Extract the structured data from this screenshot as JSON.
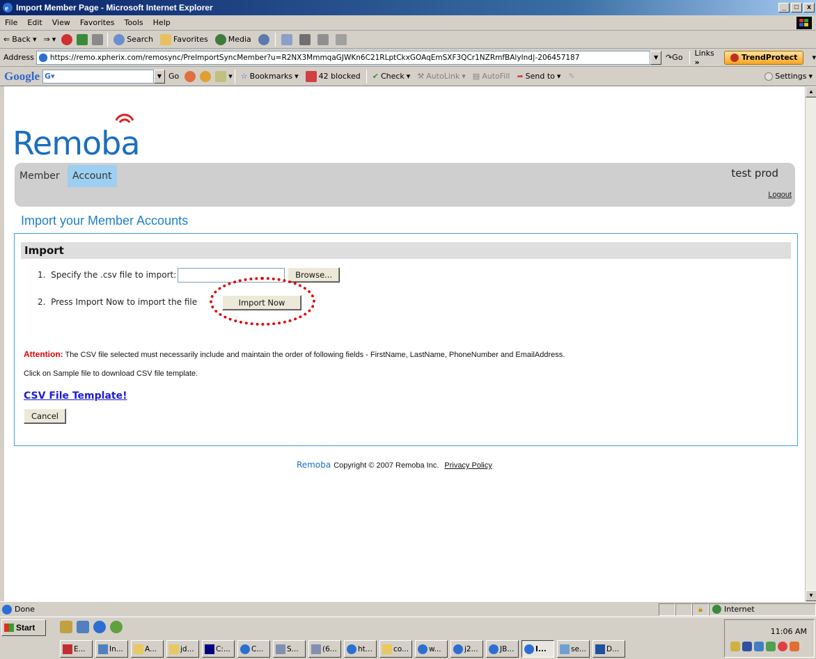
{
  "window": {
    "title": "Import Member Page - Microsoft Internet Explorer",
    "buttons": {
      "minimize": "_",
      "maximize": "□",
      "close": "x"
    }
  },
  "menu": [
    "File",
    "Edit",
    "View",
    "Favorites",
    "Tools",
    "Help"
  ],
  "toolbar": {
    "back": "Back",
    "search": "Search",
    "favorites": "Favorites",
    "media": "Media"
  },
  "address": {
    "label": "Address",
    "url": "https://remo.xpherix.com/remosync/PreImportSyncMember?u=R2NX3MmmqaGJWKn6C21RLptCkxGOAqEmSXF3QCr1NZRmfBAlyInd|-206457187",
    "go": "Go",
    "links": "Links",
    "links_chevron": "»",
    "trend": "TrendProtect"
  },
  "googlebar": {
    "logo": "Google",
    "go": "Go",
    "bookmarks": "Bookmarks",
    "blocked": "42 blocked",
    "check": "Check",
    "autolink": "AutoLink",
    "autofill": "AutoFill",
    "send_to": "Send to",
    "settings": "Settings"
  },
  "page": {
    "logo": "Remoba",
    "tabs": {
      "member": "Member",
      "account": "Account"
    },
    "username": "test prod",
    "logout": "Logout",
    "title": "Import your Member Accounts",
    "section_title": "Import",
    "step1": "1.  Specify the .csv file to import:",
    "browse": "Browse...",
    "step2": "2.  Press Import Now to import the file",
    "import_now": "Import Now",
    "attention_label": "Attention:",
    "attention_text": "The CSV file selected must necessarily include and maintain the order of following fields - FirstName, LastName, PhoneNumber and EmailAddress.",
    "sample_note": "Click on Sample file to download CSV file template.",
    "csv_link": "CSV File Template!",
    "cancel": "Cancel",
    "footer_logo": "Remoba",
    "footer_copyright": "Copyright © 2007 Remoba Inc.",
    "footer_privacy": "Privacy Policy"
  },
  "status": {
    "text": "Done",
    "zone": "Internet"
  },
  "taskbar": {
    "start": "Start",
    "clock": "11:06 AM",
    "tasks": [
      "E...",
      "In...",
      "A...",
      "jd...",
      "C:...",
      "C...",
      "S...",
      "(6...",
      "ht...",
      "co...",
      "w...",
      "j2...",
      "JB...",
      "I...",
      "se...",
      "D..."
    ],
    "active_task": "I..."
  },
  "colors": {
    "brand": "#1a6fbf",
    "accent_tab": "#9ecff0",
    "panel_border": "#3aa0de",
    "attention": "#e00000",
    "link": "#1c1ccf"
  }
}
